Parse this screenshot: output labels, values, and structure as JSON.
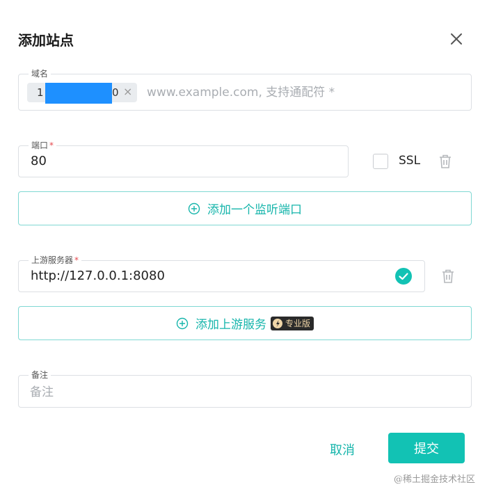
{
  "dialog": {
    "title": "添加站点",
    "close_icon": "close-icon"
  },
  "domain": {
    "label": "域名",
    "chip_prefix": "1",
    "chip_suffix": "0",
    "chip_remove": "×",
    "placeholder": "www.example.com, 支持通配符 *"
  },
  "port": {
    "label": "端口",
    "required_mark": "*",
    "value": "80",
    "ssl_label": "SSL",
    "ssl_checked": false
  },
  "add_port_button": {
    "label": "添加一个监听端口",
    "icon": "plus-circle-icon"
  },
  "upstream": {
    "label": "上游服务器",
    "required_mark": "*",
    "value": "http://127.0.0.1:8080",
    "status_icon": "check-circle-icon"
  },
  "add_upstream_button": {
    "label": "添加上游服务",
    "icon": "plus-circle-icon",
    "badge": "专业版"
  },
  "note": {
    "label": "备注",
    "placeholder": "备注"
  },
  "footer": {
    "cancel_label": "取消",
    "submit_label": "提交"
  },
  "watermark": "@稀土掘金技术社区",
  "colors": {
    "accent": "#12c2b4",
    "required": "#e5484d",
    "border": "#dcdfe3",
    "mask": "#1e90ff"
  }
}
